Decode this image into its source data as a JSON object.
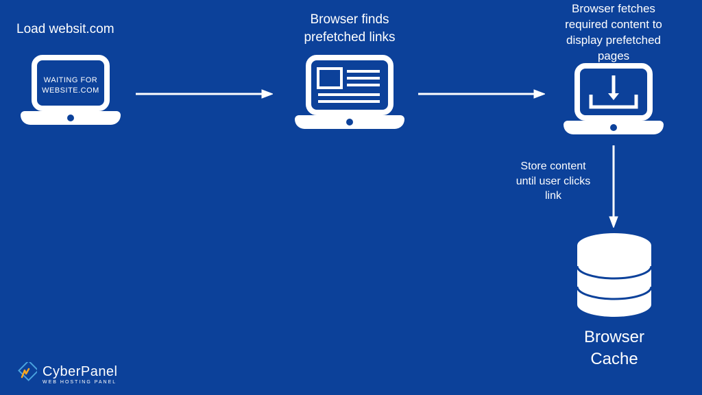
{
  "step1": {
    "title": "Load websit.com",
    "screen": "WAITING FOR\nWEBSITE.COM"
  },
  "step2": {
    "title": "Browser finds\nprefetched links"
  },
  "step3": {
    "title": "Browser fetches\nrequired content to\ndisplay prefetched\npages"
  },
  "step4": {
    "label": "Store content\nuntil user clicks\nlink"
  },
  "cache": {
    "title": "Browser\nCache"
  },
  "brand": {
    "name": "CyberPanel",
    "tag": "WEB HOSTING PANEL"
  }
}
